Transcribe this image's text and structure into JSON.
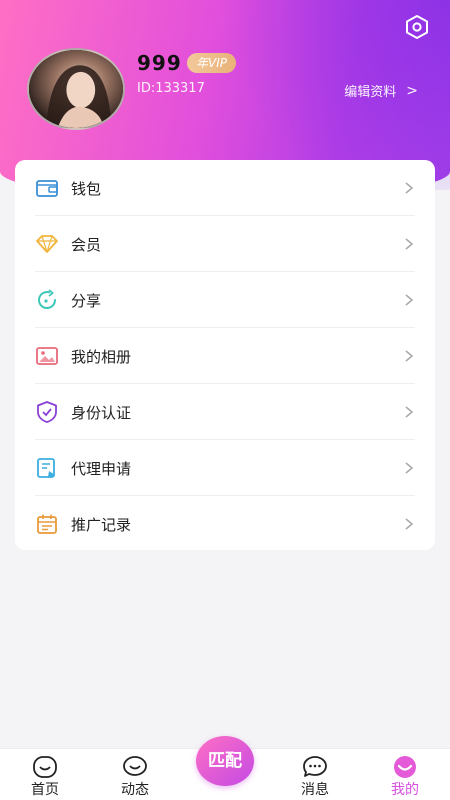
{
  "profile": {
    "nickname": "999",
    "vip_badge": "年VIP",
    "user_id": "ID:133317",
    "edit_label": "编辑资料",
    "edit_chevron": ">"
  },
  "menu": [
    {
      "label": "钱包",
      "icon": "wallet-icon",
      "color": "#3b8fd8"
    },
    {
      "label": "会员",
      "icon": "diamond-icon",
      "color": "#f0b43c"
    },
    {
      "label": "分享",
      "icon": "share-icon",
      "color": "#3cc7b8"
    },
    {
      "label": "我的相册",
      "icon": "photo-album-icon",
      "color": "#e86a7a"
    },
    {
      "label": "身份认证",
      "icon": "shield-check-icon",
      "color": "#8a3fd6"
    },
    {
      "label": "代理申请",
      "icon": "agent-apply-icon",
      "color": "#3aaee0"
    },
    {
      "label": "推广记录",
      "icon": "calendar-record-icon",
      "color": "#e99a3a"
    }
  ],
  "tabbar": {
    "home": "首页",
    "moments": "动态",
    "match": "匹配",
    "messages": "消息",
    "mine": "我的"
  },
  "colors": {
    "brand_pink": "#ff6fc4",
    "brand_purple": "#a33fe8",
    "active_tab": "#d64fdf"
  }
}
